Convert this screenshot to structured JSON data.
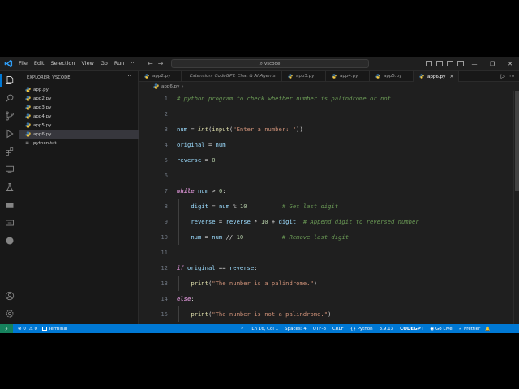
{
  "titlebar": {
    "menu": [
      "File",
      "Edit",
      "Selection",
      "View",
      "Go",
      "Run",
      "···"
    ],
    "search_text": "vscode",
    "back_glyph": "←",
    "forward_glyph": "→",
    "search_glyph": "⌕",
    "window_controls": [
      "—",
      "❐",
      "✕"
    ]
  },
  "sidebar": {
    "title": "EXPLORER: VSCODE",
    "more": "···",
    "files": [
      {
        "name": "app.py",
        "type": "python"
      },
      {
        "name": "app2.py",
        "type": "python"
      },
      {
        "name": "app3.py",
        "type": "python"
      },
      {
        "name": "app4.py",
        "type": "python"
      },
      {
        "name": "app5.py",
        "type": "python"
      },
      {
        "name": "app6.py",
        "type": "python",
        "selected": true
      },
      {
        "name": "python.txt",
        "type": "text"
      }
    ],
    "text_icon": "≡"
  },
  "tabs": [
    {
      "label": "app2.py",
      "italic": false
    },
    {
      "label": "Extension: CodeGPT: Chat & AI Agents",
      "italic": true
    },
    {
      "label": "app3.py",
      "italic": false
    },
    {
      "label": "app4.py",
      "italic": false
    },
    {
      "label": "app5.py",
      "italic": false
    },
    {
      "label": "app6.py",
      "italic": false,
      "active": true,
      "close": "×"
    }
  ],
  "tab_actions": [
    "▷",
    "⋯"
  ],
  "breadcrumb": {
    "file": "app6.py",
    "sep": "›"
  },
  "editor": {
    "lines": [
      {
        "n": "1",
        "tokens": [
          [
            "# python program to check whether number is palindrome or not",
            "comment"
          ]
        ]
      },
      {
        "n": "2",
        "tokens": []
      },
      {
        "n": "3",
        "tokens": [
          [
            "num",
            "var"
          ],
          [
            " = ",
            "op"
          ],
          [
            "int",
            "builtin"
          ],
          [
            "(",
            "op"
          ],
          [
            "input",
            "func"
          ],
          [
            "(",
            "op"
          ],
          [
            "\"Enter a number: \"",
            "str"
          ],
          [
            "))",
            "op"
          ]
        ]
      },
      {
        "n": "4",
        "tokens": [
          [
            "original",
            "var"
          ],
          [
            " = ",
            "op"
          ],
          [
            "num",
            "var"
          ]
        ]
      },
      {
        "n": "5",
        "tokens": [
          [
            "reverse",
            "var"
          ],
          [
            " = ",
            "op"
          ],
          [
            "0",
            "num"
          ]
        ]
      },
      {
        "n": "6",
        "tokens": []
      },
      {
        "n": "7",
        "tokens": [
          [
            "while",
            "kw"
          ],
          [
            " ",
            "op"
          ],
          [
            "num",
            "var"
          ],
          [
            " > ",
            "op"
          ],
          [
            "0",
            "num"
          ],
          [
            ":",
            "op"
          ]
        ]
      },
      {
        "n": "8",
        "tokens": [
          [
            "    ",
            "op"
          ],
          [
            "digit",
            "var"
          ],
          [
            " = ",
            "op"
          ],
          [
            "num",
            "var"
          ],
          [
            " % ",
            "op"
          ],
          [
            "10",
            "num"
          ],
          [
            "          ",
            "op"
          ],
          [
            "# Get last digit",
            "comment"
          ]
        ]
      },
      {
        "n": "9",
        "tokens": [
          [
            "    ",
            "op"
          ],
          [
            "reverse",
            "var"
          ],
          [
            " = ",
            "op"
          ],
          [
            "reverse",
            "var"
          ],
          [
            " * ",
            "op"
          ],
          [
            "10",
            "num"
          ],
          [
            " + ",
            "op"
          ],
          [
            "digit",
            "var"
          ],
          [
            "  ",
            "op"
          ],
          [
            "# Append digit to reversed number",
            "comment"
          ]
        ]
      },
      {
        "n": "10",
        "tokens": [
          [
            "    ",
            "op"
          ],
          [
            "num",
            "var"
          ],
          [
            " = ",
            "op"
          ],
          [
            "num",
            "var"
          ],
          [
            " // ",
            "op"
          ],
          [
            "10",
            "num"
          ],
          [
            "           ",
            "op"
          ],
          [
            "# Remove last digit",
            "comment"
          ]
        ]
      },
      {
        "n": "11",
        "tokens": []
      },
      {
        "n": "12",
        "tokens": [
          [
            "if",
            "kw"
          ],
          [
            " ",
            "op"
          ],
          [
            "original",
            "var"
          ],
          [
            " == ",
            "op"
          ],
          [
            "reverse",
            "var"
          ],
          [
            ":",
            "op"
          ]
        ]
      },
      {
        "n": "13",
        "tokens": [
          [
            "    ",
            "op"
          ],
          [
            "print",
            "func"
          ],
          [
            "(",
            "op"
          ],
          [
            "\"The number is a palindrome.\"",
            "str"
          ],
          [
            ")",
            "op"
          ]
        ]
      },
      {
        "n": "14",
        "tokens": [
          [
            "else",
            "kw"
          ],
          [
            ":",
            "op"
          ]
        ]
      },
      {
        "n": "15",
        "tokens": [
          [
            "    ",
            "op"
          ],
          [
            "print",
            "func"
          ],
          [
            "(",
            "op"
          ],
          [
            "\"The number is not a palindrome.\"",
            "str"
          ],
          [
            ")",
            "op"
          ]
        ]
      }
    ]
  },
  "statusbar": {
    "remote_glyph": "⚡",
    "errors": "⊗ 0",
    "warnings": "⚠ 0",
    "terminal": "Terminal",
    "zoom_glyph": "⌕",
    "position": "Ln 16, Col 1",
    "spaces": "Spaces: 4",
    "encoding": "UTF-8",
    "eol": "CRLF",
    "language": "{} Python",
    "version": "3.9.13",
    "codegpt": "CODEGPT",
    "golive": "◉ Go Live",
    "prettier": "✓ Prettier",
    "bell": "🔔"
  },
  "colors": {
    "accent": "#0078d4",
    "editor_bg": "#1f1f1f",
    "sidebar_bg": "#181818",
    "statusbar_bg": "#0078d4",
    "remote_bg": "#16825d"
  }
}
